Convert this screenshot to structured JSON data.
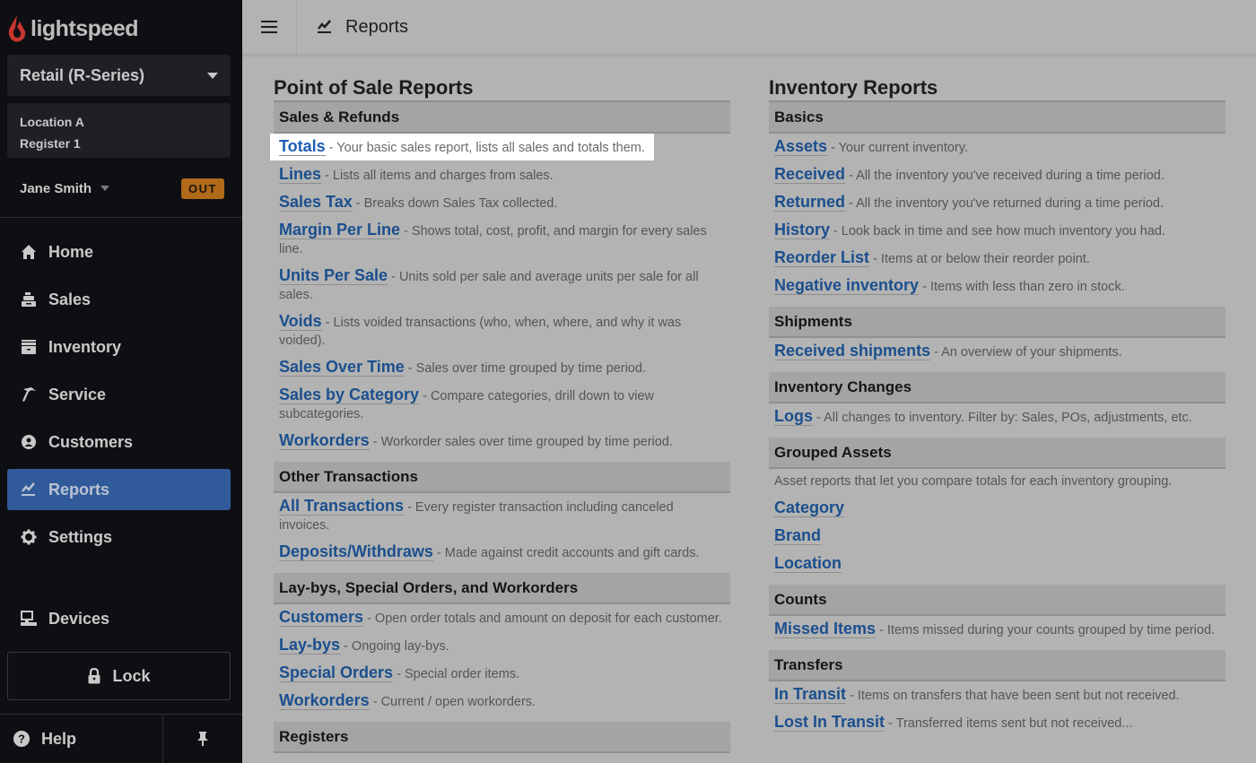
{
  "sidebar": {
    "brand": "lightspeed",
    "product_select": "Retail (R-Series)",
    "location": "Location A",
    "register": "Register 1",
    "user": "Jane Smith",
    "clock_badge": "OUT",
    "nav": [
      {
        "label": "Home",
        "icon": "home-icon"
      },
      {
        "label": "Sales",
        "icon": "register-icon"
      },
      {
        "label": "Inventory",
        "icon": "inventory-box-icon"
      },
      {
        "label": "Service",
        "icon": "hammer-icon"
      },
      {
        "label": "Customers",
        "icon": "customer-icon"
      },
      {
        "label": "Reports",
        "icon": "reports-chart-icon",
        "active": true
      },
      {
        "label": "Settings",
        "icon": "gear-icon"
      }
    ],
    "devices": "Devices",
    "lock": "Lock",
    "help": "Help"
  },
  "topbar": {
    "title": "Reports"
  },
  "colors": {
    "sidebar_bg": "#0e0f13",
    "active_nav": "#315a9a",
    "out_badge": "#b06a1a",
    "link": "#1b4f8e"
  },
  "pos_reports": {
    "title": "Point of Sale Reports",
    "sections": [
      {
        "heading": "Sales & Refunds",
        "items": [
          {
            "link": "Totals",
            "desc": " - Your basic sales report, lists all sales and totals them."
          },
          {
            "link": "Lines",
            "desc": " - Lists all items and charges from sales."
          },
          {
            "link": "Sales Tax",
            "desc": " - Breaks down Sales Tax collected."
          },
          {
            "link": "Margin Per Line",
            "desc": " - Shows total, cost, profit, and margin for every sales line."
          },
          {
            "link": "Units Per Sale",
            "desc": " - Units sold per sale and average units per sale for all sales."
          },
          {
            "link": "Voids",
            "desc": " - Lists voided transactions (who, when, where, and why it was voided)."
          },
          {
            "link": "Sales Over Time",
            "desc": " - Sales over time grouped by time period."
          },
          {
            "link": "Sales by Category",
            "desc": " - Compare categories, drill down to view subcategories."
          },
          {
            "link": "Workorders",
            "desc": " - Workorder sales over time grouped by time period."
          }
        ]
      },
      {
        "heading": "Other Transactions",
        "items": [
          {
            "link": "All Transactions",
            "desc": " - Every register transaction including canceled invoices."
          },
          {
            "link": "Deposits/Withdraws",
            "desc": " - Made against credit accounts and gift cards."
          }
        ]
      },
      {
        "heading": "Lay-bys, Special Orders, and Workorders",
        "items": [
          {
            "link": "Customers",
            "desc": " - Open order totals and amount on deposit for each customer."
          },
          {
            "link": "Lay-bys",
            "desc": " - Ongoing lay-bys."
          },
          {
            "link": "Special Orders",
            "desc": " - Special order items."
          },
          {
            "link": "Workorders",
            "desc": " - Current / open workorders."
          }
        ]
      },
      {
        "heading": "Registers",
        "items": []
      }
    ]
  },
  "inventory_reports": {
    "title": "Inventory Reports",
    "sections": [
      {
        "heading": "Basics",
        "items": [
          {
            "link": "Assets",
            "desc": " - Your current inventory."
          },
          {
            "link": "Received",
            "desc": " - All the inventory you've received during a time period."
          },
          {
            "link": "Returned",
            "desc": " - All the inventory you've returned during a time period."
          },
          {
            "link": "History",
            "desc": " - Look back in time and see how much inventory you had."
          },
          {
            "link": "Reorder List",
            "desc": " - Items at or below their reorder point."
          },
          {
            "link": "Negative inventory",
            "desc": " - Items with less than zero in stock."
          }
        ]
      },
      {
        "heading": "Shipments",
        "items": [
          {
            "link": "Received shipments",
            "desc": " - An overview of your shipments."
          }
        ]
      },
      {
        "heading": "Inventory Changes",
        "items": [
          {
            "link": "Logs",
            "desc": " - All changes to inventory. Filter by: Sales, POs, adjustments, etc."
          }
        ]
      },
      {
        "heading": "Grouped Assets",
        "note": "Asset reports that let you compare totals for each inventory grouping.",
        "items": [
          {
            "link": "Category",
            "desc": ""
          },
          {
            "link": "Brand",
            "desc": ""
          },
          {
            "link": "Location",
            "desc": ""
          }
        ]
      },
      {
        "heading": "Counts",
        "items": [
          {
            "link": "Missed Items",
            "desc": " - Items missed during your counts grouped by time period."
          }
        ]
      },
      {
        "heading": "Transfers",
        "items": [
          {
            "link": "In Transit",
            "desc": " - Items on transfers that have been sent but not received."
          },
          {
            "link": "Lost In Transit",
            "desc": " - Transferred items sent but not received..."
          }
        ]
      }
    ]
  }
}
